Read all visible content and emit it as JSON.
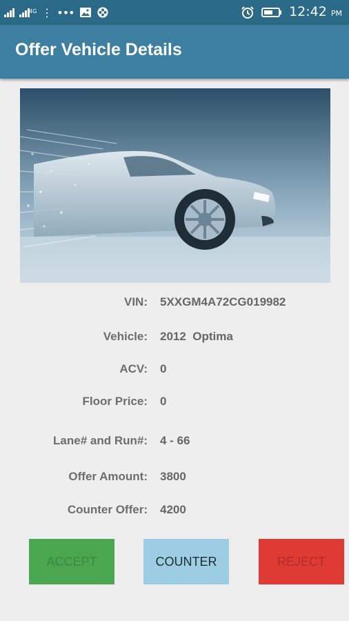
{
  "status_bar": {
    "network_label": "4G",
    "time": "12:42",
    "time_suffix": "PM",
    "icons": [
      "signal-icon",
      "signal-4g-icon",
      "overflow-dots-icon",
      "more-dots-icon",
      "image-notification-icon",
      "app-notification-icon",
      "alarm-icon",
      "battery-icon"
    ]
  },
  "app_bar": {
    "title": "Offer Vehicle Details"
  },
  "hero_image": {
    "description": "car-dissolving-into-water-splash"
  },
  "details": [
    {
      "label": "VIN:",
      "value": "5XXGM4A72CG019982"
    },
    {
      "label": "Vehicle:",
      "value": "2012  Optima"
    },
    {
      "label": "ACV:",
      "value": "0"
    },
    {
      "label": "Floor Price:",
      "value": "0"
    },
    {
      "label": "Lane# and Run#:",
      "value": "4 - 66"
    },
    {
      "label": "Offer Amount:",
      "value": "3800"
    },
    {
      "label": "Counter Offer:",
      "value": "4200"
    }
  ],
  "actions": {
    "accept_label": "ACCEPT",
    "counter_label": "COUNTER",
    "reject_label": "REJECT"
  },
  "colors": {
    "status_bar": "#2a6a88",
    "app_bar": "#3d7fa0",
    "accept": "#4aa64f",
    "counter": "#9dcde2",
    "reject": "#dd3b33",
    "background": "#eeeeee"
  }
}
